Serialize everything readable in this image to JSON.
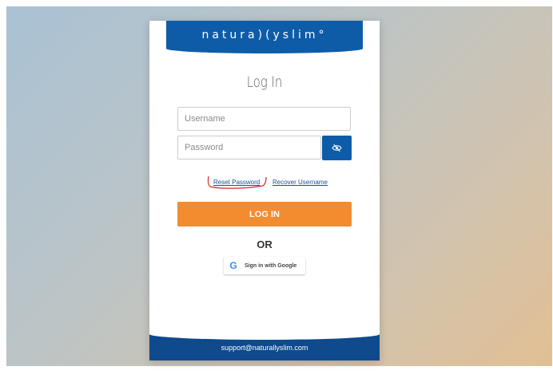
{
  "brand": {
    "logo_text": "natura)(yslim°",
    "primary_color": "#0e5ca8",
    "footer_color": "#0e4a8c",
    "accent_color": "#f38b2f"
  },
  "login": {
    "title": "Log In",
    "username_placeholder": "Username",
    "password_placeholder": "Password",
    "toggle_icon": "eye-slash-icon",
    "reset_password_label": "Reset Password",
    "recover_username_label": "Recover Username",
    "login_button_label": "LOG IN",
    "or_label": "OR",
    "google_button_label": "Sign in with Google",
    "google_icon": "G"
  },
  "footer": {
    "support_email": "support@naturallyslim.com"
  }
}
